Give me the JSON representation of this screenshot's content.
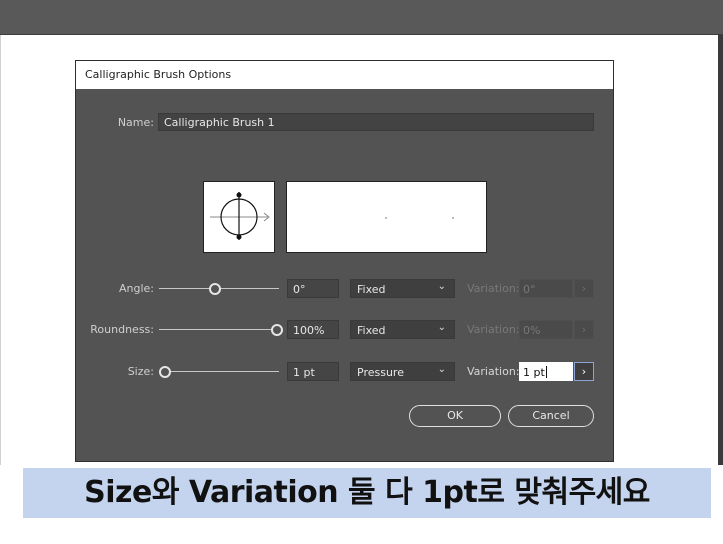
{
  "dialog": {
    "title": "Calligraphic Brush Options",
    "name_label": "Name:",
    "name_value": "Calligraphic Brush 1",
    "rows": [
      {
        "label": "Angle:",
        "value": "0°",
        "mode": "Fixed",
        "variation_label": "Variation:",
        "variation_value": "0°",
        "variation_enabled": false,
        "slider_level": 0.45
      },
      {
        "label": "Roundness:",
        "value": "100%",
        "mode": "Fixed",
        "variation_label": "Variation:",
        "variation_value": "0%",
        "variation_enabled": false,
        "slider_level": 1.0
      },
      {
        "label": "Size:",
        "value": "1 pt",
        "mode": "Pressure",
        "variation_label": "Variation:",
        "variation_value": "1 pt",
        "variation_enabled": true,
        "slider_level": 0.0
      }
    ],
    "ok_label": "OK",
    "cancel_label": "Cancel",
    "chevron_glyph": "⌄",
    "stepper_glyph": "›"
  },
  "caption": {
    "text": "Size와 Variation 둘 다 1pt로 맞춰주세요",
    "background": "#c4d3ee"
  },
  "colors": {
    "dialog_bg": "#535353",
    "titlebar_bg": "#ffffff",
    "topbar_bg": "#595959"
  },
  "icons": [
    "angle-roundness-preview-icon",
    "chevron-down-icon",
    "stepper-arrow-icon"
  ]
}
